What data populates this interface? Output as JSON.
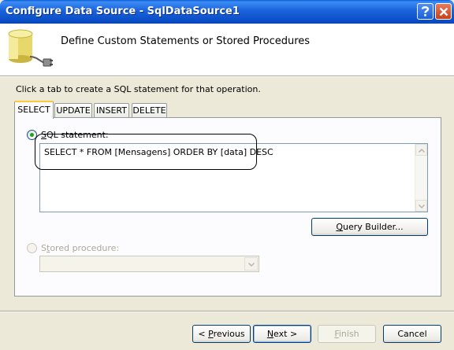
{
  "window": {
    "title": "Configure Data Source - SqlDataSource1",
    "help_icon": "question-mark-icon",
    "close_icon": "close-x-icon"
  },
  "header": {
    "title": "Define Custom Statements or Stored Procedures",
    "icon": "database-plug-icon"
  },
  "instructions": "Click a tab to create a SQL statement for that operation.",
  "tabs": [
    {
      "label": "SELECT",
      "active": true
    },
    {
      "label": "UPDATE",
      "active": false
    },
    {
      "label": "INSERT",
      "active": false
    },
    {
      "label": "DELETE",
      "active": false
    }
  ],
  "sql_option": {
    "label_accel": "S",
    "label_rest": "QL statement:",
    "checked": true,
    "value": "SELECT * FROM [Mensagens] ORDER BY [data] DESC"
  },
  "query_builder_label": {
    "accel": "Q",
    "rest": "uery Builder..."
  },
  "stored_option": {
    "label_accel": "t",
    "label_pre": "S",
    "label_rest": "ored procedure:",
    "checked": false,
    "value": ""
  },
  "footer": {
    "previous": {
      "pre": "< ",
      "accel": "P",
      "rest": "revious"
    },
    "next": {
      "accel": "N",
      "rest": "ext >"
    },
    "finish": {
      "accel": "F",
      "rest": "inish"
    },
    "cancel": "Cancel"
  },
  "colors": {
    "titlebar": "#0b4fc8",
    "dialog_bg": "#ece9d8",
    "active_tab_accent": "#ffc83c"
  }
}
